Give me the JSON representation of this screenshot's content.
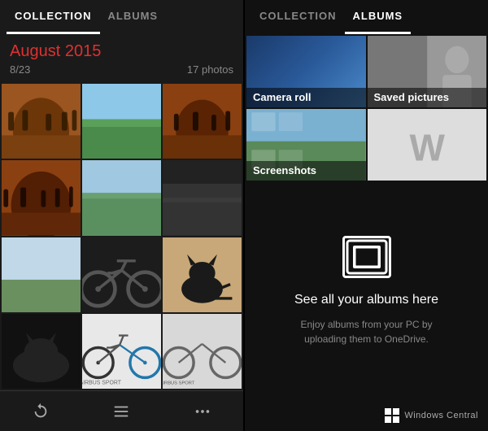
{
  "left": {
    "tabs": [
      {
        "label": "COLLECTION",
        "active": true
      },
      {
        "label": "ALBUMS",
        "active": false
      }
    ],
    "date": "August 2015",
    "date_sub_left": "8/23",
    "date_sub_right": "17 photos",
    "photos": [
      {
        "type": "tunnel",
        "id": 1
      },
      {
        "type": "field",
        "id": 2
      },
      {
        "type": "tunnel2",
        "id": 3
      },
      {
        "type": "field2",
        "id": 4
      },
      {
        "type": "tunnel3",
        "id": 5
      },
      {
        "type": "dark",
        "id": 6
      },
      {
        "type": "landscape",
        "id": 7
      },
      {
        "type": "bike",
        "id": 8
      },
      {
        "type": "cat",
        "id": 9
      },
      {
        "type": "cat2",
        "id": 10
      },
      {
        "type": "bike-product",
        "id": 11
      },
      {
        "type": "bike-product2",
        "id": 12
      }
    ],
    "bottom_icons": [
      "refresh",
      "list",
      "more"
    ]
  },
  "right": {
    "tabs": [
      {
        "label": "COLLECTION",
        "active": false
      },
      {
        "label": "ALBUMS",
        "active": true
      }
    ],
    "albums": [
      {
        "label": "Camera roll",
        "type": "camera"
      },
      {
        "label": "Saved pictures",
        "type": "saved"
      },
      {
        "label": "Screenshots",
        "type": "screenshots"
      },
      {
        "label": "",
        "type": "w"
      }
    ],
    "onedrive": {
      "title": "See all your albums here",
      "description": "Enjoy albums from your PC by uploading them to OneDrive."
    },
    "footer": {
      "brand": "Windows Central"
    }
  }
}
